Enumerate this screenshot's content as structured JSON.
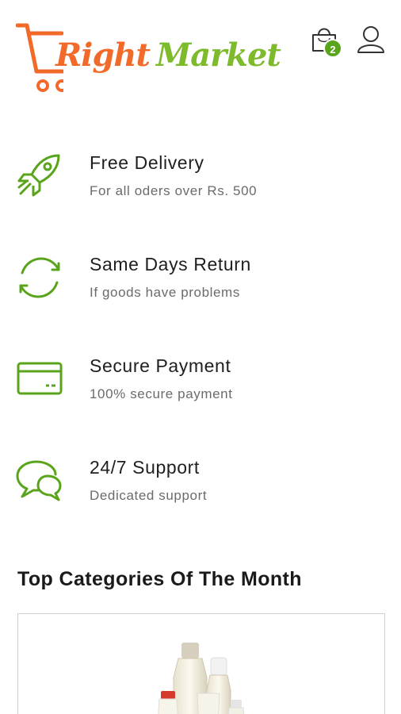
{
  "header": {
    "logo": {
      "part1": "R",
      "part2": "ight",
      "part3": "Market"
    },
    "cart_count": "2"
  },
  "features": [
    {
      "icon": "rocket-icon",
      "title": "Free Delivery",
      "subtitle": "For all oders over Rs. 500"
    },
    {
      "icon": "refresh-icon",
      "title": "Same Days Return",
      "subtitle": "If goods have problems"
    },
    {
      "icon": "credit-card-icon",
      "title": "Secure Payment",
      "subtitle": "100% secure payment"
    },
    {
      "icon": "chat-bubbles-icon",
      "title": "24/7 Support",
      "subtitle": "Dedicated support"
    }
  ],
  "section": {
    "title": "Top Categories Of The Month"
  },
  "colors": {
    "brand_orange": "#f26a2a",
    "brand_green": "#7dbb2c",
    "badge_green": "#5aa41c"
  }
}
